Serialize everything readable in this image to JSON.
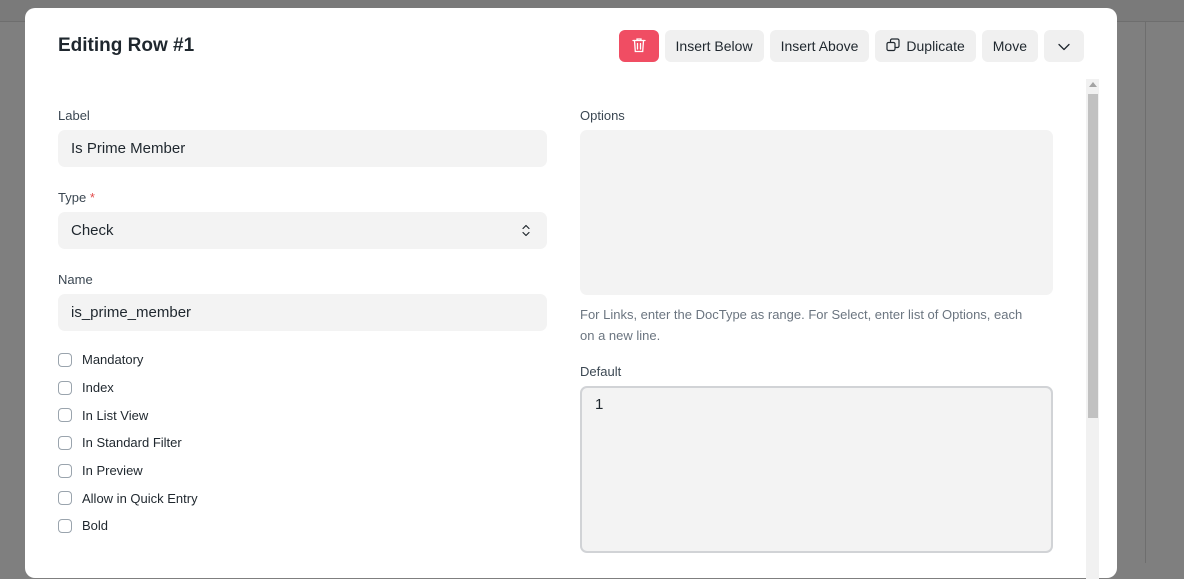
{
  "dialog": {
    "title": "Editing Row #1",
    "actions": {
      "delete_icon": "trash-icon",
      "insert_below": "Insert Below",
      "insert_above": "Insert Above",
      "duplicate": "Duplicate",
      "duplicate_icon": "duplicate-icon",
      "move": "Move",
      "more_icon": "chevron-down-icon"
    }
  },
  "form": {
    "label": {
      "label": "Label",
      "value": "Is Prime Member"
    },
    "type": {
      "label": "Type",
      "required_mark": "*",
      "value": "Check"
    },
    "name": {
      "label": "Name",
      "value": "is_prime_member"
    },
    "checkboxes": [
      {
        "label": "Mandatory",
        "checked": false
      },
      {
        "label": "Index",
        "checked": false
      },
      {
        "label": "In List View",
        "checked": false
      },
      {
        "label": "In Standard Filter",
        "checked": false
      },
      {
        "label": "In Preview",
        "checked": false
      },
      {
        "label": "Allow in Quick Entry",
        "checked": false
      },
      {
        "label": "Bold",
        "checked": false
      }
    ],
    "options": {
      "label": "Options",
      "value": "",
      "help": "For Links, enter the DocType as range. For Select, enter list of Options, each on a new line."
    },
    "default": {
      "label": "Default",
      "value": "1"
    }
  },
  "colors": {
    "danger": "#f04d63",
    "input_bg": "#f3f3f3",
    "button_bg": "#f0f0f0"
  }
}
